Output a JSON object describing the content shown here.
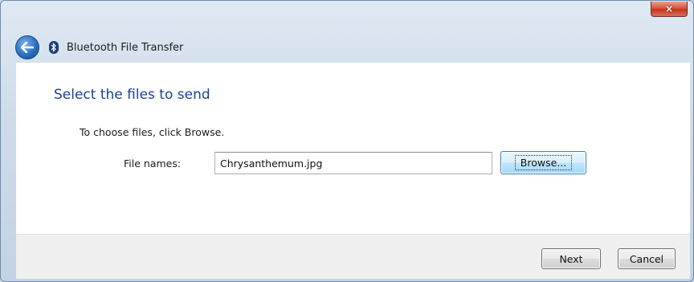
{
  "window": {
    "title": "Bluetooth File Transfer",
    "close_glyph": "×"
  },
  "icons": {
    "back": "back-arrow-icon",
    "bluetooth": "bluetooth-icon"
  },
  "page": {
    "heading": "Select the files to send",
    "instruction": "To choose files, click Browse.",
    "file_names_label": "File names:",
    "file_names_value": "Chrysanthemum.jpg",
    "browse_label": "Browse..."
  },
  "footer": {
    "next_label": "Next",
    "cancel_label": "Cancel"
  },
  "colors": {
    "heading": "#1c3f94",
    "close_button": "#c2361f",
    "browse_focus": "#3c7fb1"
  }
}
